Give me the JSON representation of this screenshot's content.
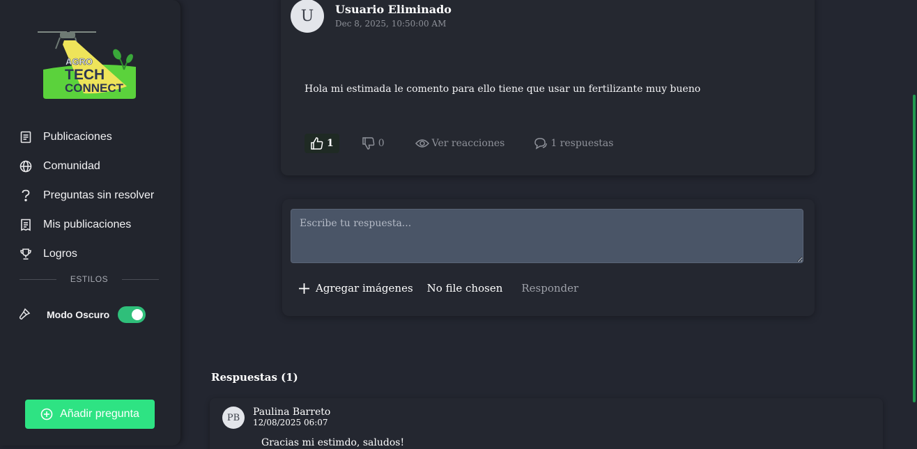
{
  "sidebar": {
    "logo": {
      "line1": "AGRO",
      "line2": "TECH",
      "line3": "CONNECT"
    },
    "items": [
      {
        "label": "Publicaciones",
        "icon": "document-icon"
      },
      {
        "label": "Comunidad",
        "icon": "globe-icon"
      },
      {
        "label": "Preguntas sin resolver",
        "icon": "question-icon"
      },
      {
        "label": "Mis publicaciones",
        "icon": "receipt-icon"
      },
      {
        "label": "Logros",
        "icon": "trophy-icon"
      }
    ],
    "section_label": "ESTILOS",
    "dark_mode": {
      "label": "Modo Oscuro",
      "enabled": true,
      "icon": "brush-icon"
    },
    "add_button": "Añadir pregunta"
  },
  "post": {
    "avatar_initial": "U",
    "author": "Usuario Eliminado",
    "date": "Dec 8, 2025, 10:50:00 AM",
    "body": "Hola mi estimada le comento para ello tiene que usar un fertilizante muy bueno",
    "likes": "1",
    "dislikes": "0",
    "views_label": "Ver reacciones",
    "replies_label": "1 respuestas"
  },
  "reply_form": {
    "placeholder": "Escribe tu respuesta...",
    "add_images": "Agregar imágenes",
    "file_status": "No file chosen",
    "submit": "Responder"
  },
  "replies": {
    "title": "Respuestas (1)",
    "items": [
      {
        "initials": "PB",
        "author": "Paulina Barreto",
        "date": "12/08/2025 06:07",
        "text": "Gracias mi estimdo, saludos!"
      }
    ]
  },
  "colors": {
    "accent": "#2ee383",
    "toggle": "#2fbf7a",
    "background": "#232630"
  }
}
